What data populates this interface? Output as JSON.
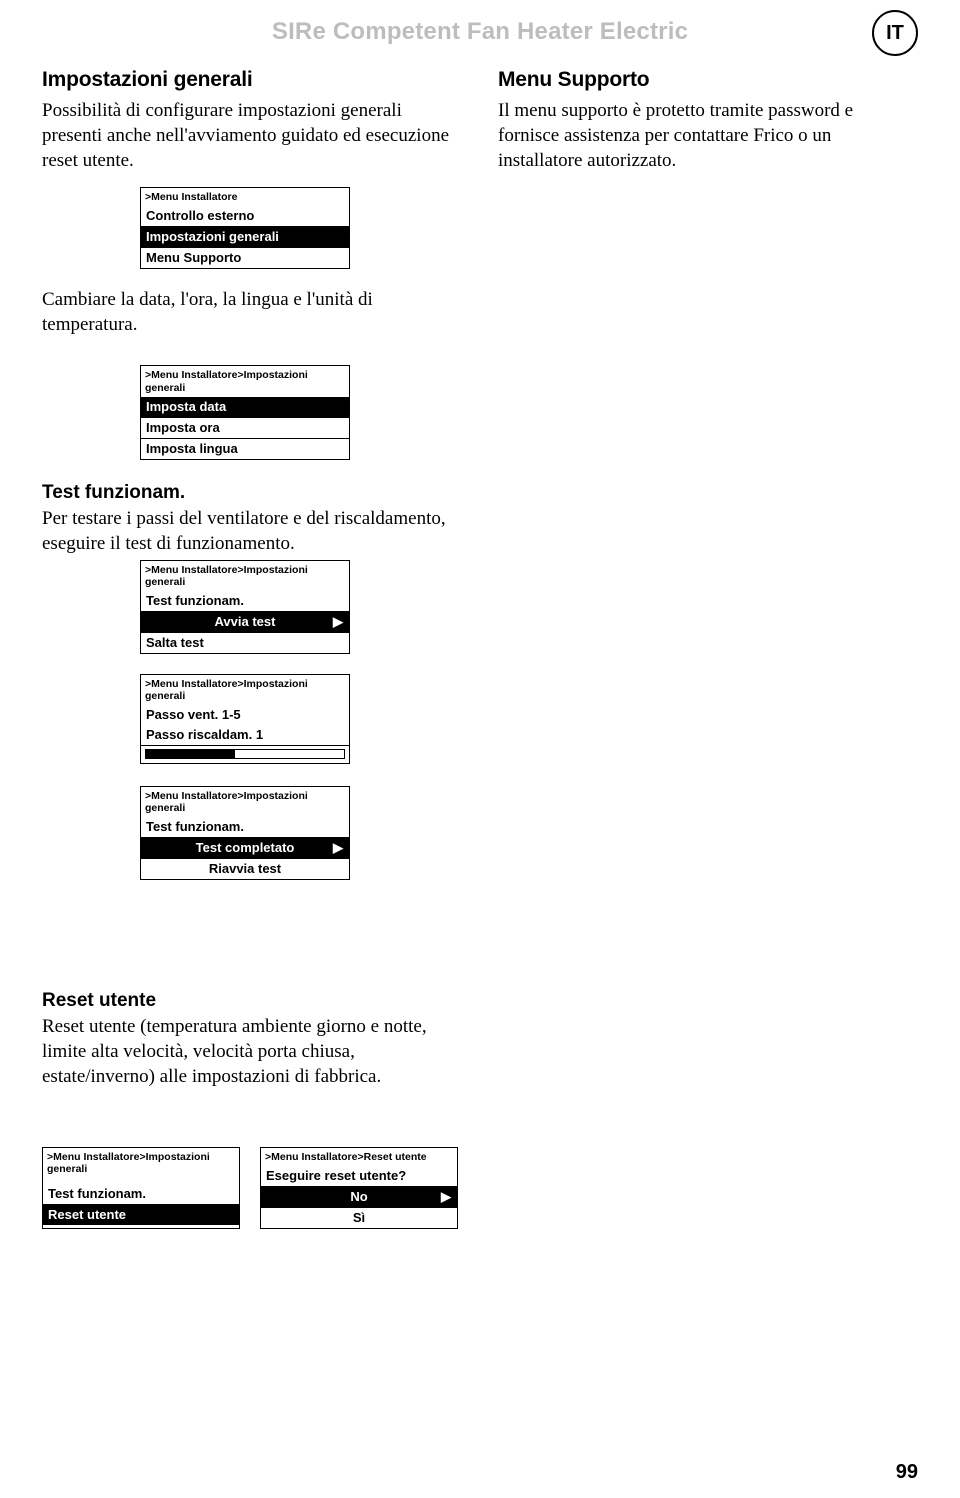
{
  "header": {
    "title": "SIRe Competent Fan Heater  Electric",
    "lang": "IT"
  },
  "left": {
    "h1": "Impostazioni generali",
    "p1": "Possibilità di configurare impostazioni generali presenti anche nell'avviamento guidato ed esecuzione reset utente.",
    "menu1": {
      "crumb": ">Menu Installatore",
      "i1": "Controllo esterno",
      "i2": "Impostazioni generali",
      "i3": "Menu Supporto"
    },
    "p2": "Cambiare la data, l'ora, la lingua e l'unità di temperatura.",
    "menu2": {
      "crumb": ">Menu Installatore>Impostazioni generali",
      "i1": "Imposta data",
      "i2": "Imposta ora",
      "i3": "Imposta lingua"
    },
    "test_h": "Test funzionam.",
    "test_p": "Per testare i passi del ventilatore e del riscaldamento, eseguire il test di funzionamento.",
    "menu3": {
      "crumb": ">Menu Installatore>Impostazioni generali",
      "i1": "Test funzionam.",
      "i2": "Avvia test",
      "i3": "Salta test"
    },
    "menu4": {
      "crumb": ">Menu Installatore>Impostazioni generali",
      "i1": "Passo vent. 1-5",
      "i2": "Passo riscaldam. 1"
    },
    "menu5": {
      "crumb": ">Menu Installatore>Impostazioni generali",
      "i1": "Test funzionam.",
      "i2": "Test completato",
      "i3": "Riavvia test"
    },
    "reset_h": "Reset utente",
    "reset_p": "Reset utente (temperatura ambiente giorno e notte, limite alta velocità, velocità porta chiusa, estate/inverno) alle impostazioni di fabbrica.",
    "menu6": {
      "crumb": ">Menu Installatore>Impostazioni generali",
      "i1": "Test funzionam.",
      "i2": "Reset utente"
    },
    "menu7": {
      "crumb": ">Menu Installatore>Reset utente",
      "i1": "Eseguire reset utente?",
      "i2": "No",
      "i3": "Sì"
    }
  },
  "right": {
    "h1": "Menu Supporto",
    "p1": "Il menu supporto è protetto tramite password e fornisce assistenza per contattare Frico o un installatore autorizzato."
  },
  "arrow": "▶",
  "page_num": "99"
}
